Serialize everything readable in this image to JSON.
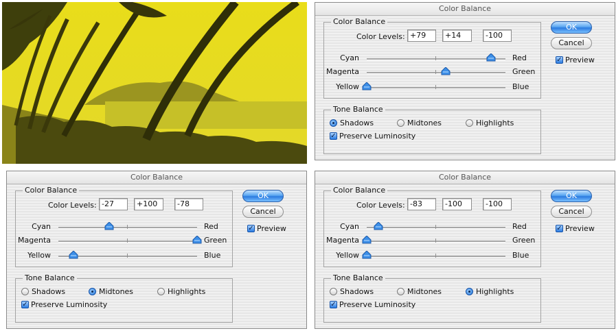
{
  "dialogs": [
    {
      "title": "Color Balance",
      "group_label": "Color Balance",
      "levels_label": "Color Levels:",
      "levels": [
        "+79",
        "+14",
        "-100"
      ],
      "sliders": [
        {
          "left": "Cyan",
          "right": "Red",
          "value": 79
        },
        {
          "left": "Magenta",
          "right": "Green",
          "value": 14
        },
        {
          "left": "Yellow",
          "right": "Blue",
          "value": -100
        }
      ],
      "tone_label": "Tone Balance",
      "tones": [
        "Shadows",
        "Midtones",
        "Highlights"
      ],
      "selected_tone": "Shadows",
      "preserve_label": "Preserve Luminosity",
      "preserve_checked": true,
      "ok_label": "OK",
      "cancel_label": "Cancel",
      "preview_label": "Preview",
      "preview_checked": true
    },
    {
      "title": "Color Balance",
      "group_label": "Color Balance",
      "levels_label": "Color Levels:",
      "levels": [
        "-27",
        "+100",
        "-78"
      ],
      "sliders": [
        {
          "left": "Cyan",
          "right": "Red",
          "value": -27
        },
        {
          "left": "Magenta",
          "right": "Green",
          "value": 100
        },
        {
          "left": "Yellow",
          "right": "Blue",
          "value": -78
        }
      ],
      "tone_label": "Tone Balance",
      "tones": [
        "Shadows",
        "Midtones",
        "Highlights"
      ],
      "selected_tone": "Midtones",
      "preserve_label": "Preserve Luminosity",
      "preserve_checked": true,
      "ok_label": "OK",
      "cancel_label": "Cancel",
      "preview_label": "Preview",
      "preview_checked": true
    },
    {
      "title": "Color Balance",
      "group_label": "Color Balance",
      "levels_label": "Color Levels:",
      "levels": [
        "-83",
        "-100",
        "-100"
      ],
      "sliders": [
        {
          "left": "Cyan",
          "right": "Red",
          "value": -83
        },
        {
          "left": "Magenta",
          "right": "Green",
          "value": -100
        },
        {
          "left": "Yellow",
          "right": "Blue",
          "value": -100
        }
      ],
      "tone_label": "Tone Balance",
      "tones": [
        "Shadows",
        "Midtones",
        "Highlights"
      ],
      "selected_tone": "Highlights",
      "preserve_label": "Preserve Luminosity",
      "preserve_checked": true,
      "ok_label": "OK",
      "cancel_label": "Cancel",
      "preview_label": "Preview",
      "preview_checked": true
    }
  ],
  "colors": {
    "accent_blue": "#2c7be0",
    "photo_tint": "#d8cc1e"
  }
}
